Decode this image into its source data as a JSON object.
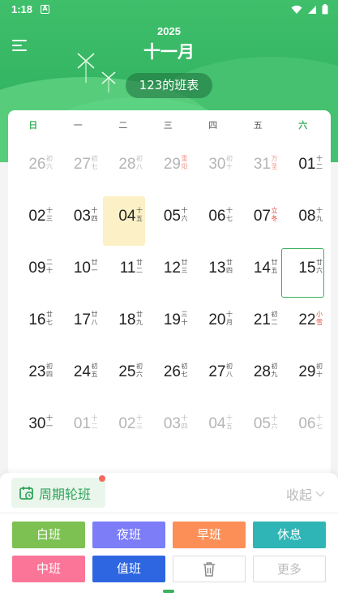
{
  "status_bar": {
    "time": "1:18",
    "notification_icon": "A"
  },
  "header": {
    "year": "2025",
    "month": "十一月",
    "schedule_name": "123的班表"
  },
  "weekdays": [
    "日",
    "一",
    "二",
    "三",
    "四",
    "五",
    "六"
  ],
  "calendar": [
    [
      {
        "n": "26",
        "l": "初六",
        "dim": true
      },
      {
        "n": "27",
        "l": "初七",
        "dim": true
      },
      {
        "n": "28",
        "l": "初八",
        "dim": true
      },
      {
        "n": "29",
        "l": "重阳",
        "dim": true,
        "red": true
      },
      {
        "n": "30",
        "l": "初十",
        "dim": true
      },
      {
        "n": "31",
        "l": "万圣",
        "dim": true,
        "red": true
      },
      {
        "n": "01",
        "l": "十二"
      }
    ],
    [
      {
        "n": "02",
        "l": "十三"
      },
      {
        "n": "03",
        "l": "十四"
      },
      {
        "n": "04",
        "l": "十五",
        "today": true
      },
      {
        "n": "05",
        "l": "十六"
      },
      {
        "n": "06",
        "l": "十七"
      },
      {
        "n": "07",
        "l": "立冬",
        "red": true
      },
      {
        "n": "08",
        "l": "十九"
      }
    ],
    [
      {
        "n": "09",
        "l": "二十"
      },
      {
        "n": "10",
        "l": "廿一"
      },
      {
        "n": "11",
        "l": "廿二"
      },
      {
        "n": "12",
        "l": "廿三"
      },
      {
        "n": "13",
        "l": "廿四"
      },
      {
        "n": "14",
        "l": "廿五"
      },
      {
        "n": "15",
        "l": "廿六",
        "selected": true
      }
    ],
    [
      {
        "n": "16",
        "l": "廿七"
      },
      {
        "n": "17",
        "l": "廿八"
      },
      {
        "n": "18",
        "l": "廿九"
      },
      {
        "n": "19",
        "l": "三十"
      },
      {
        "n": "20",
        "l": "十月"
      },
      {
        "n": "21",
        "l": "初二"
      },
      {
        "n": "22",
        "l": "小雪",
        "red": true
      }
    ],
    [
      {
        "n": "23",
        "l": "初四"
      },
      {
        "n": "24",
        "l": "初五"
      },
      {
        "n": "25",
        "l": "初六"
      },
      {
        "n": "26",
        "l": "初七"
      },
      {
        "n": "27",
        "l": "初八"
      },
      {
        "n": "28",
        "l": "初九"
      },
      {
        "n": "29",
        "l": "初十"
      }
    ],
    [
      {
        "n": "30",
        "l": "十一"
      },
      {
        "n": "01",
        "l": "十二",
        "dim": true
      },
      {
        "n": "02",
        "l": "十三",
        "dim": true
      },
      {
        "n": "03",
        "l": "十四",
        "dim": true
      },
      {
        "n": "04",
        "l": "十五",
        "dim": true
      },
      {
        "n": "05",
        "l": "十六",
        "dim": true
      },
      {
        "n": "06",
        "l": "十七",
        "dim": true
      }
    ]
  ],
  "panel": {
    "cycle_label": "周期轮班",
    "collapse_label": "收起",
    "shifts": [
      {
        "label": "白班",
        "color": "#7cc152"
      },
      {
        "label": "夜班",
        "color": "#7c7df7"
      },
      {
        "label": "早班",
        "color": "#fb8f57"
      },
      {
        "label": "休息",
        "color": "#2fb5b5"
      },
      {
        "label": "中班",
        "color": "#fb7598"
      },
      {
        "label": "值班",
        "color": "#2d66e0"
      }
    ],
    "more_label": "更多"
  },
  "colors": {
    "accent": "#3db15f",
    "today_bg": "#fcf1c6",
    "holiday_red": "#e24a3a"
  }
}
